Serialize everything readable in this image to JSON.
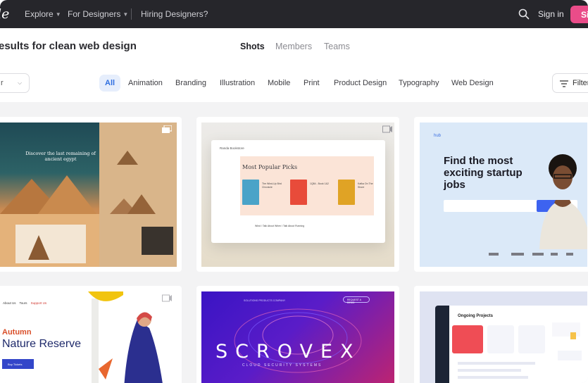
{
  "topnav": {
    "logo_text": "le",
    "explore": "Explore",
    "for_designers": "For Designers",
    "hiring": "Hiring Designers?",
    "sign_in": "Sign in",
    "sign_up": "Si"
  },
  "header": {
    "results_title": "esults for clean web design",
    "tabs": [
      "Shots",
      "Members",
      "Teams"
    ],
    "active_tab": "Shots"
  },
  "filters": {
    "sort_value": "r",
    "categories": [
      "All",
      "Animation",
      "Branding",
      "Illustration",
      "Mobile",
      "Print",
      "Product Design",
      "Typography",
      "Web Design"
    ],
    "active_category": "All",
    "filters_label": "Filter"
  },
  "shots": {
    "egypt": {
      "headline": "Discover the last remaining of ancient egypt"
    },
    "books": {
      "header": "Randa Bookstore",
      "section": "Most Popular Picks",
      "items": [
        {
          "title": "The Wind-Up Bird Chronicle",
          "color": "#4aa3c8"
        },
        {
          "title": "1Q84 - Book 1&2",
          "color": "#e84b3a"
        },
        {
          "title": "Kafka On The Shore",
          "color": "#e0a325"
        }
      ],
      "now_playing": "Wind / Talk About When I Talk About Running"
    },
    "hub": {
      "logo": "hub",
      "headline": "Find the most exciting startup jobs",
      "accent": "#3d63f0"
    },
    "autumn": {
      "nav": [
        "About Us",
        "Tours",
        "Support Us"
      ],
      "label": "Autumn",
      "headline": "Nature Reserve",
      "button": "Buy Tickets"
    },
    "scrovex": {
      "nav": "SOLUTIONS   PRODUCTS   COMPANY",
      "title": "SCROVEX",
      "subtitle": "CLOUD SECURITY SYSTEMS",
      "request": "REQUEST A DEMO"
    },
    "dashboard": {
      "title": "Ongoing Projects",
      "accent": "#ef4d55"
    }
  },
  "icons": {
    "search": "search-icon",
    "chevron": "chevron-down-icon",
    "filters": "filter-icon",
    "multi_shot": "multi-shot-icon"
  }
}
